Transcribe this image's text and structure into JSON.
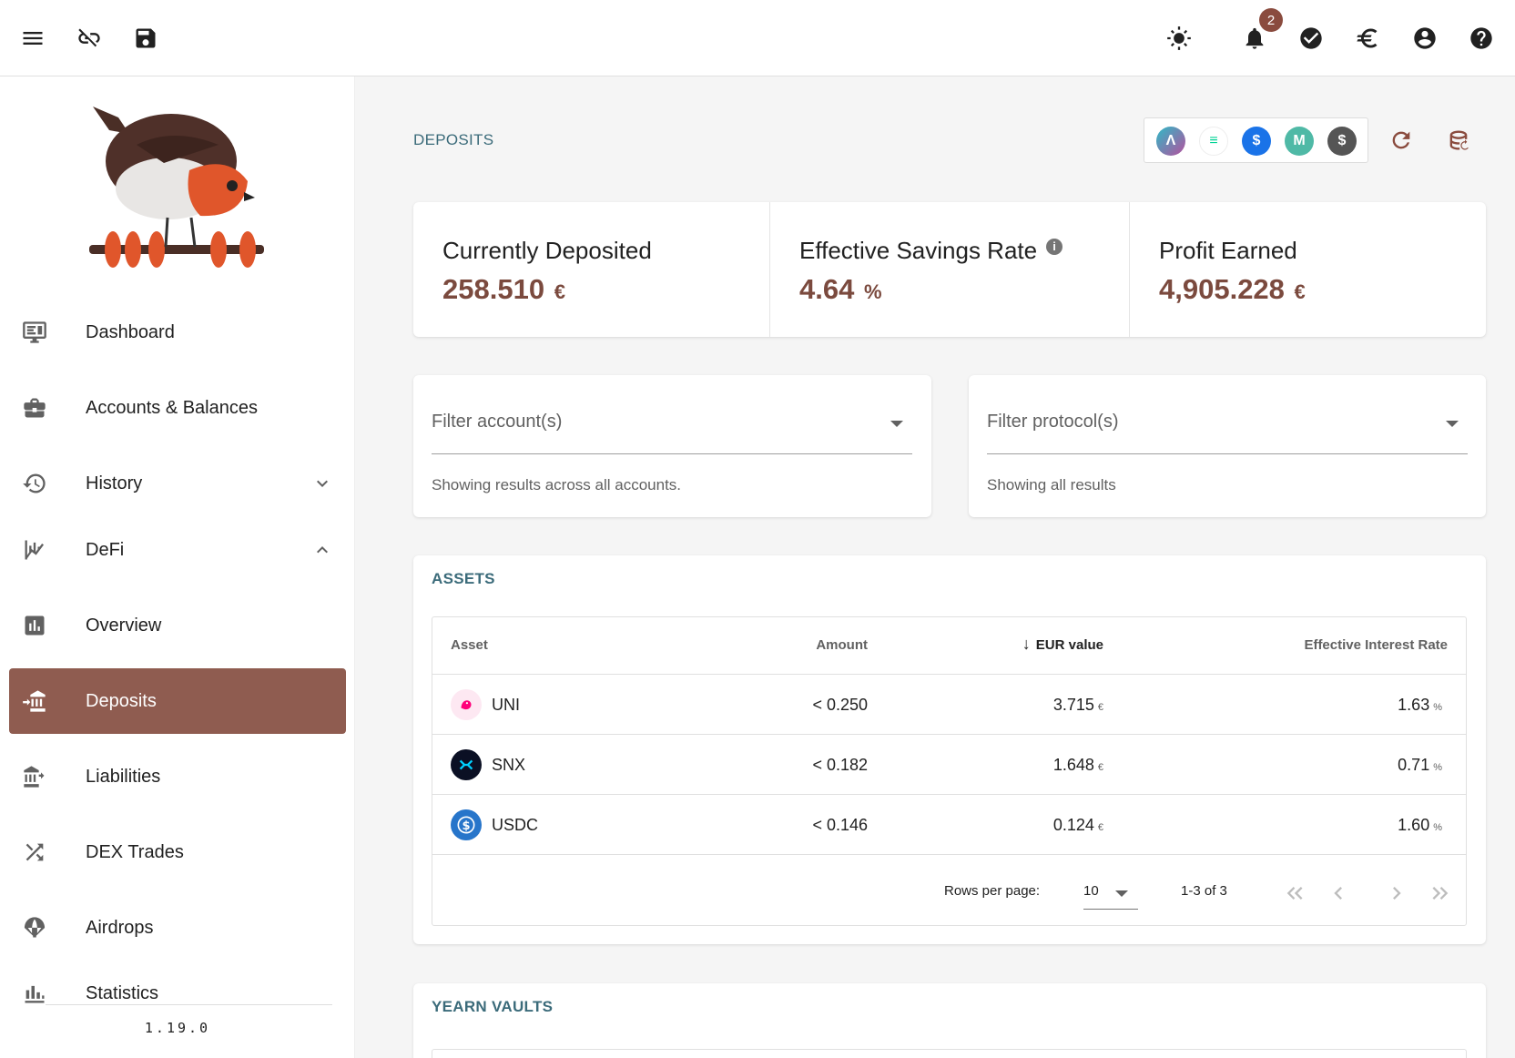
{
  "notifications": {
    "count": "2"
  },
  "sidebar": {
    "items": [
      {
        "label": "Dashboard"
      },
      {
        "label": "Accounts & Balances"
      },
      {
        "label": "History"
      },
      {
        "label": "DeFi"
      },
      {
        "label": "Overview"
      },
      {
        "label": "Deposits"
      },
      {
        "label": "Liabilities"
      },
      {
        "label": "DEX Trades"
      },
      {
        "label": "Airdrops"
      },
      {
        "label": "Statistics"
      }
    ],
    "active": "Deposits",
    "version": "1.19.0"
  },
  "page": {
    "title": "DEPOSITS"
  },
  "protocols": [
    {
      "icon": "aave-icon",
      "color": "#2ebac6"
    },
    {
      "icon": "compound-icon",
      "color": "#00d395"
    },
    {
      "icon": "dsr-icon",
      "color": "#1a73e8"
    },
    {
      "icon": "maker-icon",
      "color": "#4fb9a6"
    },
    {
      "icon": "yearn-icon",
      "color": "#555555"
    }
  ],
  "stats": {
    "deposited": {
      "title": "Currently Deposited",
      "value": "258.510",
      "unit": "€"
    },
    "rate": {
      "title": "Effective Savings Rate",
      "value": "4.64",
      "unit": "%"
    },
    "profit": {
      "title": "Profit Earned",
      "value": "4,905.228",
      "unit": "€"
    }
  },
  "filters": {
    "account": {
      "placeholder": "Filter account(s)",
      "hint": "Showing results across all accounts."
    },
    "protocol": {
      "placeholder": "Filter protocol(s)",
      "hint": "Showing all results"
    }
  },
  "assets": {
    "title": "ASSETS",
    "headers": {
      "asset": "Asset",
      "amount": "Amount",
      "value": "EUR value",
      "rate": "Effective Interest Rate"
    },
    "rows": [
      {
        "asset": "UNI",
        "amount": "< 0.250",
        "value": "3.715",
        "value_unit": "€",
        "rate": "1.63",
        "rate_unit": "%"
      },
      {
        "asset": "SNX",
        "amount": "< 0.182",
        "value": "1.648",
        "value_unit": "€",
        "rate": "0.71",
        "rate_unit": "%"
      },
      {
        "asset": "USDC",
        "amount": "< 0.146",
        "value": "0.124",
        "value_unit": "€",
        "rate": "1.60",
        "rate_unit": "%"
      }
    ],
    "footer": {
      "rows_per_page_label": "Rows per page:",
      "rows_per_page": "10",
      "range": "1-3 of 3"
    }
  },
  "yearn": {
    "title": "YEARN VAULTS"
  }
}
